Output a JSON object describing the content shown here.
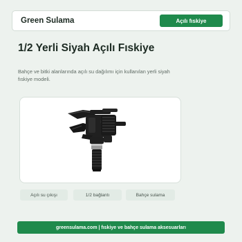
{
  "header": {
    "brand": "Green Sulama",
    "button_label": "Açılı fıskiye"
  },
  "page": {
    "title": "1/2 Yerli Siyah Açılı Fıskiye",
    "description": "Bahçe ve bitki alanlarında açılı su dağılımı için kullanılan yerli siyah fıskiye modeli."
  },
  "product": {
    "icon": "impact-sprinkler-icon"
  },
  "tags": [
    "Açılı su çıkışı",
    "1/2 bağlantı",
    "Bahçe sulama"
  ],
  "footer": {
    "text": "greensulama.com | fıskiye ve bahçe sulama aksesuarları"
  },
  "colors": {
    "accent": "#1f8a4c",
    "background": "#edf2ee",
    "tag_bg": "#e2ebe5"
  }
}
